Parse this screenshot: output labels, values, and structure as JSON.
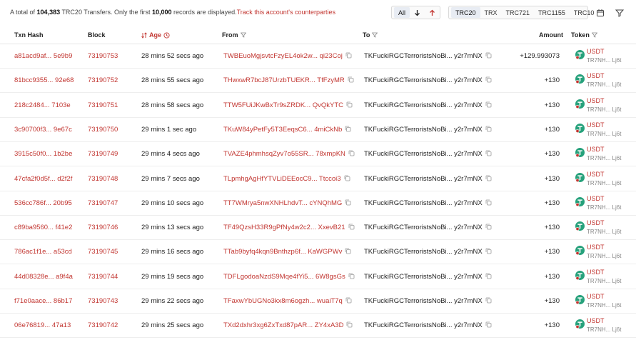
{
  "summary": {
    "prefix": "A total of",
    "total": "104,383",
    "mid": "TRC20 Transfers. Only the first",
    "limit": "10,000",
    "suffix": "records are displayed.",
    "link": "Track this account's counterparties"
  },
  "direction_filter": {
    "all": "All"
  },
  "token_tabs": [
    "TRC20",
    "TRX",
    "TRC721",
    "TRC1155",
    "TRC10"
  ],
  "columns": {
    "txn_hash": "Txn Hash",
    "block": "Block",
    "age": "Age",
    "from": "From",
    "to": "To",
    "amount": "Amount",
    "token": "Token"
  },
  "rows": [
    {
      "hash": "a81acd9af... 5e9b9",
      "block": "73190753",
      "age": "28 mins 52 secs ago",
      "from": "TWBEuoMgjsvtcFzyEL4ok2w... qi23Coj",
      "to": "TKFuckiRGCTerroristsNoBi... y2r7mNX",
      "amount": "+129.993073",
      "token": "USDT",
      "token_addr": "TR7NH... Lj6t"
    },
    {
      "hash": "81bcc9355... 92e68",
      "block": "73190752",
      "age": "28 mins 55 secs ago",
      "from": "THwxwR7bcJ87UrzbTUEKR... TfFzyMR",
      "to": "TKFuckiRGCTerroristsNoBi... y2r7mNX",
      "amount": "+130",
      "token": "USDT",
      "token_addr": "TR7NH... Lj6t"
    },
    {
      "hash": "218c2484... 7103e",
      "block": "73190751",
      "age": "28 mins 58 secs ago",
      "from": "TTW5FUiJKwBxTr9sZRDK... QvQkYTC",
      "to": "TKFuckiRGCTerroristsNoBi... y2r7mNX",
      "amount": "+130",
      "token": "USDT",
      "token_addr": "TR7NH... Lj6t"
    },
    {
      "hash": "3c90700f3... 9e67c",
      "block": "73190750",
      "age": "29 mins 1 sec ago",
      "from": "TKuW84yPetFy5T3EeqsC6... 4miCkNb",
      "to": "TKFuckiRGCTerroristsNoBi... y2r7mNX",
      "amount": "+130",
      "token": "USDT",
      "token_addr": "TR7NH... Lj6t"
    },
    {
      "hash": "3915c50f0... 1b2be",
      "block": "73190749",
      "age": "29 mins 4 secs ago",
      "from": "TVAZE4phmhsqZyv7o55SR... 78xmpKN",
      "to": "TKFuckiRGCTerroristsNoBi... y2r7mNX",
      "amount": "+130",
      "token": "USDT",
      "token_addr": "TR7NH... Lj6t"
    },
    {
      "hash": "47cfa2f0d5f... d2f2f",
      "block": "73190748",
      "age": "29 mins 7 secs ago",
      "from": "TLpmhgAgHfYTVLiDEEocC9... Ttccoi3",
      "to": "TKFuckiRGCTerroristsNoBi... y2r7mNX",
      "amount": "+130",
      "token": "USDT",
      "token_addr": "TR7NH... Lj6t"
    },
    {
      "hash": "536cc786f... 20b95",
      "block": "73190747",
      "age": "29 mins 10 secs ago",
      "from": "TT7WMrya5nwXNHLhdvT... cYNQhMG",
      "to": "TKFuckiRGCTerroristsNoBi... y2r7mNX",
      "amount": "+130",
      "token": "USDT",
      "token_addr": "TR7NH... Lj6t"
    },
    {
      "hash": "c89ba9560... f41e2",
      "block": "73190746",
      "age": "29 mins 13 secs ago",
      "from": "TF49QzsH33R9gPfNy4w2c2... XxevB21",
      "to": "TKFuckiRGCTerroristsNoBi... y2r7mNX",
      "amount": "+130",
      "token": "USDT",
      "token_addr": "TR7NH... Lj6t"
    },
    {
      "hash": "786ac1f1e... a53cd",
      "block": "73190745",
      "age": "29 mins 16 secs ago",
      "from": "TTab9byfq4kqn9Bnthzp6f... KaWGPWv",
      "to": "TKFuckiRGCTerroristsNoBi... y2r7mNX",
      "amount": "+130",
      "token": "USDT",
      "token_addr": "TR7NH... Lj6t"
    },
    {
      "hash": "44d08328e... a9f4a",
      "block": "73190744",
      "age": "29 mins 19 secs ago",
      "from": "TDFLgodoaNzdS9Mqe4fYi5... 6W8gsGs",
      "to": "TKFuckiRGCTerroristsNoBi... y2r7mNX",
      "amount": "+130",
      "token": "USDT",
      "token_addr": "TR7NH... Lj6t"
    },
    {
      "hash": "f71e0aace... 86b17",
      "block": "73190743",
      "age": "29 mins 22 secs ago",
      "from": "TFaxwYbUGNo3kx8m6ogzh... wuaiT7q",
      "to": "TKFuckiRGCTerroristsNoBi... y2r7mNX",
      "amount": "+130",
      "token": "USDT",
      "token_addr": "TR7NH... Lj6t"
    },
    {
      "hash": "06e76819... 47a13",
      "block": "73190742",
      "age": "29 mins 25 secs ago",
      "from": "TXd2dxhr3xg6ZxTxd87pAR... ZY4xA3D",
      "to": "TKFuckiRGCTerroristsNoBi... y2r7mNX",
      "amount": "+130",
      "token": "USDT",
      "token_addr": "TR7NH... Lj6t"
    }
  ],
  "colors": {
    "accent_red": "#c23631",
    "tether_green": "#26a17b",
    "text_dark": "#222222",
    "border": "#eeeeee"
  }
}
